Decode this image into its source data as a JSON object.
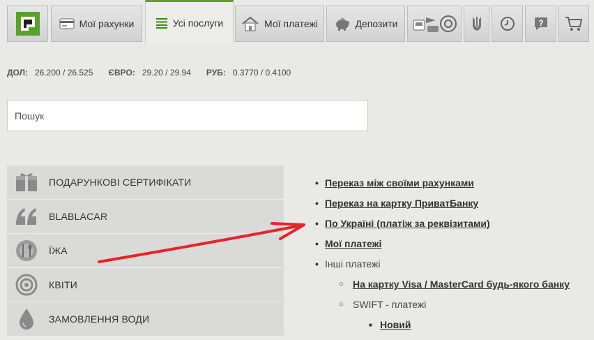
{
  "nav": {
    "accounts_label": "Мої рахунки",
    "services_label": "Усі послуги",
    "payments_label": "Мої платежі",
    "deposits_label": "Депозити"
  },
  "rates": {
    "usd_label": "ДОЛ:",
    "usd_value": "26.200 / 26.525",
    "eur_label": "ЄВРО:",
    "eur_value": "29.20 / 29.94",
    "rub_label": "РУБ:",
    "rub_value": "0.3770 / 0.4100"
  },
  "search": {
    "placeholder": "Пошук"
  },
  "categories": [
    {
      "label": "ПОДАРУНКОВІ СЕРТИФІКАТИ",
      "icon": "gift-icon"
    },
    {
      "label": "BLABLACAR",
      "icon": "quote-icon"
    },
    {
      "label": "ЇЖА",
      "icon": "food-icon"
    },
    {
      "label": "КВІТИ",
      "icon": "flower-icon"
    },
    {
      "label": "ЗАМОВЛЕННЯ ВОДИ",
      "icon": "water-drop-icon"
    }
  ],
  "links": {
    "own_transfer": "Переказ між своїми рахунками",
    "privat_card": "Переказ на картку ПриватБанку",
    "ukraine": "По Україні (платіж за реквізитами)",
    "my_payments": "Мої платежі",
    "other": "Інші платежі",
    "visa_mc": "На картку Visa / MasterCard будь-якого банку",
    "swift": "SWIFT - платежі",
    "new": "Новий"
  },
  "colors": {
    "brand_green": "#6a9a2a",
    "arrow_red": "#e8232a"
  }
}
